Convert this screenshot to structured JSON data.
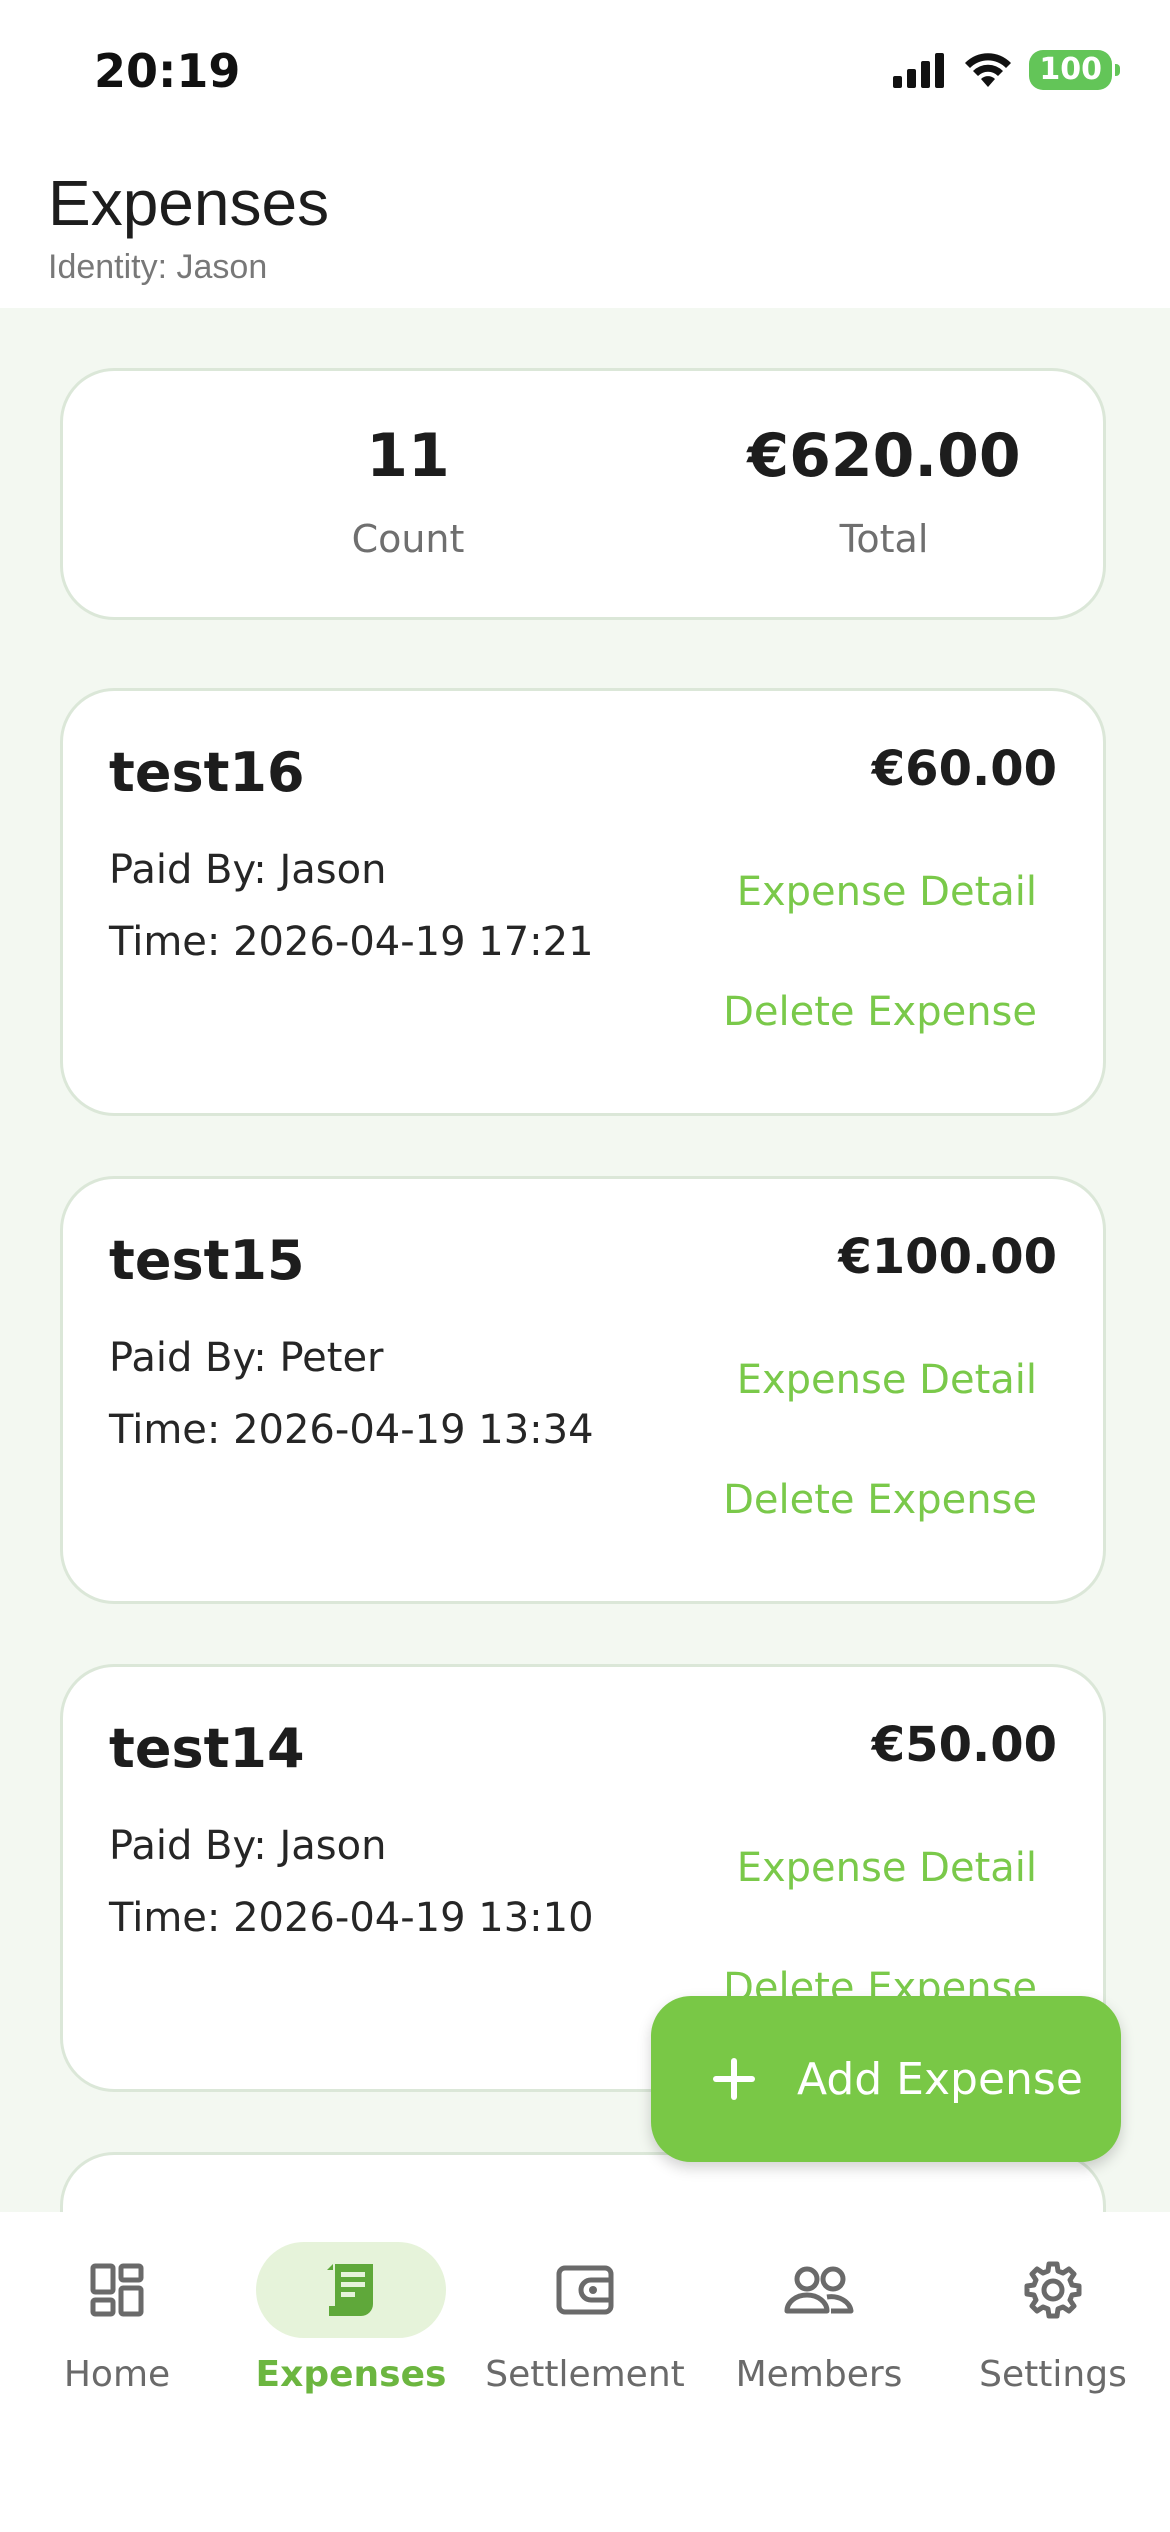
{
  "status_bar": {
    "time": "20:19",
    "battery": "100"
  },
  "header": {
    "title": "Expenses",
    "subtitle": "Identity: Jason"
  },
  "summary": {
    "count_value": "11",
    "count_label": "Count",
    "total_value": "€620.00",
    "total_label": "Total"
  },
  "expenses": [
    {
      "name": "test16",
      "amount": "€60.00",
      "paid_by": "Paid By: Jason",
      "time": "Time: 2026-04-19 17:21",
      "detail_label": "Expense Detail",
      "delete_label": "Delete Expense"
    },
    {
      "name": "test15",
      "amount": "€100.00",
      "paid_by": "Paid By: Peter",
      "time": "Time: 2026-04-19 13:34",
      "detail_label": "Expense Detail",
      "delete_label": "Delete Expense"
    },
    {
      "name": "test14",
      "amount": "€50.00",
      "paid_by": "Paid By: Jason",
      "time": "Time: 2026-04-19 13:10",
      "detail_label": "Expense Detail",
      "delete_label": "Delete Expense"
    }
  ],
  "fab": {
    "label": "Add Expense",
    "icon": "plus-icon"
  },
  "nav": {
    "items": [
      {
        "label": "Home",
        "icon": "dashboard-icon"
      },
      {
        "label": "Expenses",
        "icon": "receipt-icon",
        "active": true
      },
      {
        "label": "Settlement",
        "icon": "wallet-icon"
      },
      {
        "label": "Members",
        "icon": "people-icon"
      },
      {
        "label": "Settings",
        "icon": "gear-icon"
      }
    ]
  },
  "colors": {
    "accent": "#79c846",
    "accent_text": "#6cb640",
    "background": "#f3f8f1",
    "card_border": "#dbe7d8"
  }
}
